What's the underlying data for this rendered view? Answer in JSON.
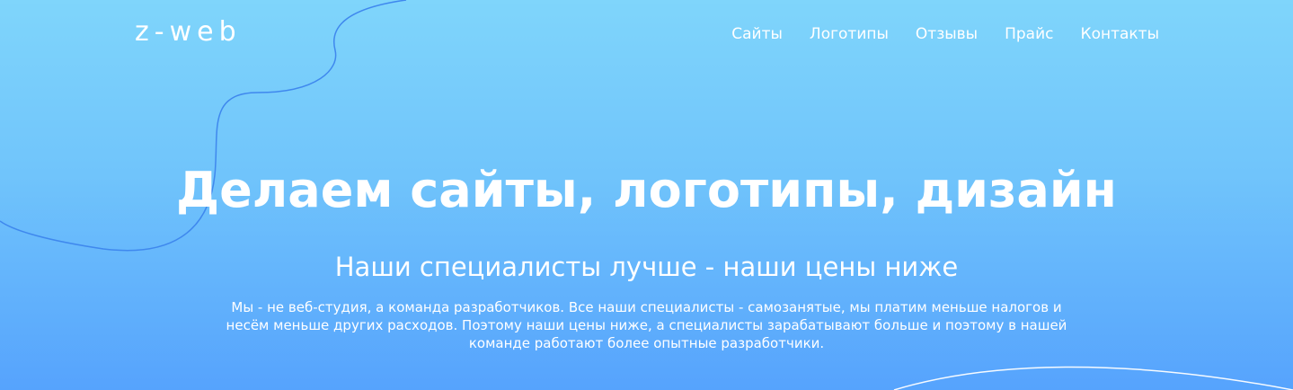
{
  "header": {
    "logo": "z-web",
    "nav": [
      "Сайты",
      "Логотипы",
      "Отзывы",
      "Прайс",
      "Контакты"
    ]
  },
  "hero": {
    "title": "Делаем сайты, логотипы, дизайн",
    "subtitle": "Наши специалисты лучше - наши цены ниже",
    "description_lines": [
      "Мы - не веб-студия, а команда разработчиков. Все наши специалисты - самозанятые, мы платим меньше налогов и",
      "несём меньше других расходов. Поэтому наши цены ниже, а специалисты зарабатывают больше и поэтому в нашей",
      "команде работают более опытные разработчики."
    ]
  },
  "colors": {
    "background_top": "#7fd5fb",
    "background_bottom": "#56a3fd",
    "text": "#ffffff",
    "decorative_line": "#3f88ee"
  }
}
